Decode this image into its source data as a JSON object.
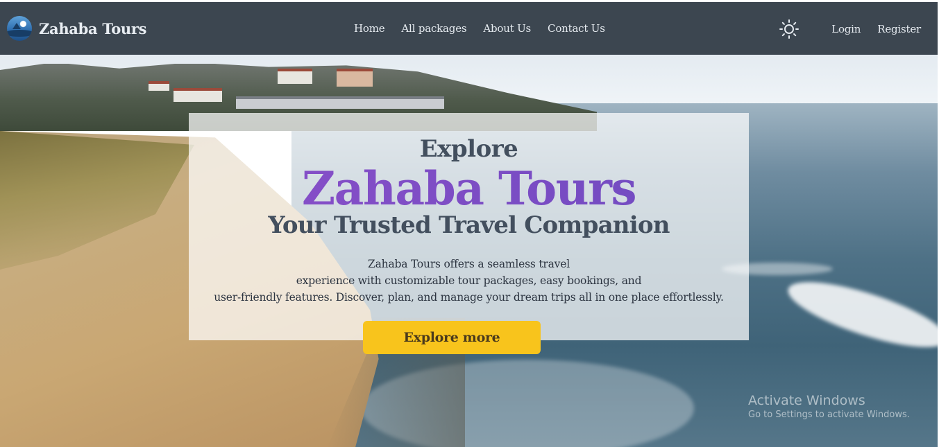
{
  "navbar": {
    "brand": "Zahaba Tours",
    "links": [
      "Home",
      "All packages",
      "About Us",
      "Contact Us"
    ],
    "login": "Login",
    "register": "Register"
  },
  "hero": {
    "pre_title": "Explore",
    "title": "Zahaba Tours",
    "tagline": "Your Trusted Travel Companion",
    "description_lines": [
      "Zahaba Tours offers a seamless travel",
      "experience with customizable tour packages, easy bookings, and",
      "user-friendly features. Discover, plan, and manage your dream trips all in one place effortlessly."
    ],
    "cta_label": "Explore more"
  },
  "os_watermark": {
    "line1": "Activate Windows",
    "line2": "Go to Settings to activate Windows."
  },
  "colors": {
    "navbar_bg": "#3c4650",
    "title_purple": "#7b45c0",
    "cta_yellow": "#f8c41c"
  },
  "icons": {
    "logo": "beach-logo-icon",
    "theme_toggle": "sun-icon"
  }
}
